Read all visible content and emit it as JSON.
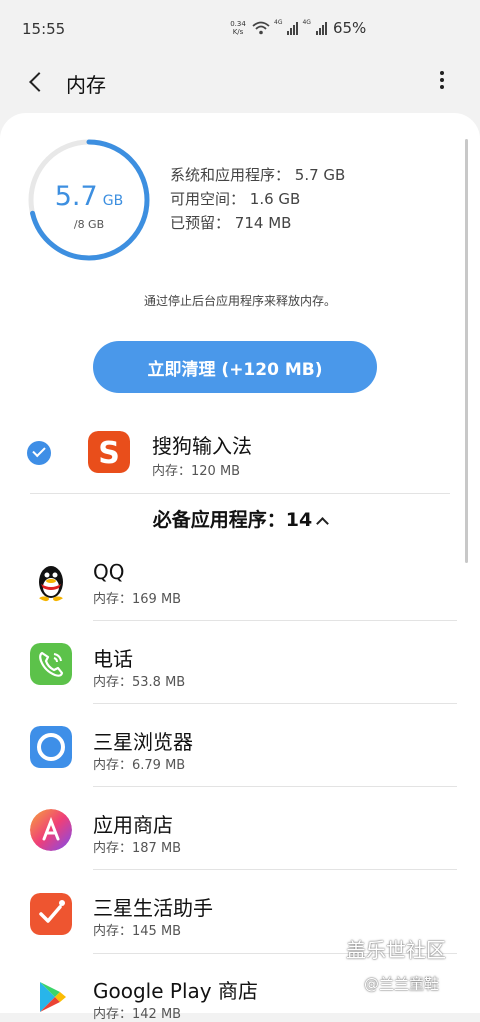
{
  "status_bar": {
    "time": "15:55",
    "net_speed_value": "0.34",
    "net_speed_unit": "K/s",
    "sim1_label": "4G",
    "sim2_label": "4G",
    "battery": "65%"
  },
  "app_bar": {
    "title": "内存"
  },
  "memory": {
    "used_value": "5.7",
    "used_unit": "GB",
    "total": "/8 GB",
    "ring_fraction": 0.7125,
    "ring_color": "#3d8fe0",
    "stats": [
      {
        "label": "系统和应用程序：",
        "value": "5.7 GB"
      },
      {
        "label": "可用空间：",
        "value": "1.6 GB"
      },
      {
        "label": "已预留：",
        "value": "714 MB"
      }
    ]
  },
  "hint": "通过停止后台应用程序来释放内存。",
  "clean_button": {
    "label": "立即清理 (+120 MB)",
    "color": "#4a98ea"
  },
  "selected_app": {
    "name": "搜狗输入法",
    "mem": "内存：120 MB",
    "icon": "sogou-icon"
  },
  "section": {
    "title": "必备应用程序：",
    "count": "14"
  },
  "apps": [
    {
      "name": "QQ",
      "mem": "内存：169 MB",
      "icon": "qq-icon"
    },
    {
      "name": "电话",
      "mem": "内存：53.8 MB",
      "icon": "phone-icon"
    },
    {
      "name": "三星浏览器",
      "mem": "内存：6.79 MB",
      "icon": "browser-icon"
    },
    {
      "name": "应用商店",
      "mem": "内存：187 MB",
      "icon": "app-store-icon"
    },
    {
      "name": "三星生活助手",
      "mem": "内存：145 MB",
      "icon": "life-assistant-icon"
    },
    {
      "name": "Google Play 商店",
      "mem": "内存：142 MB",
      "icon": "play-store-icon"
    }
  ],
  "watermark": {
    "line1": "盖乐世社区",
    "line2": "@兰兰童鞋"
  }
}
